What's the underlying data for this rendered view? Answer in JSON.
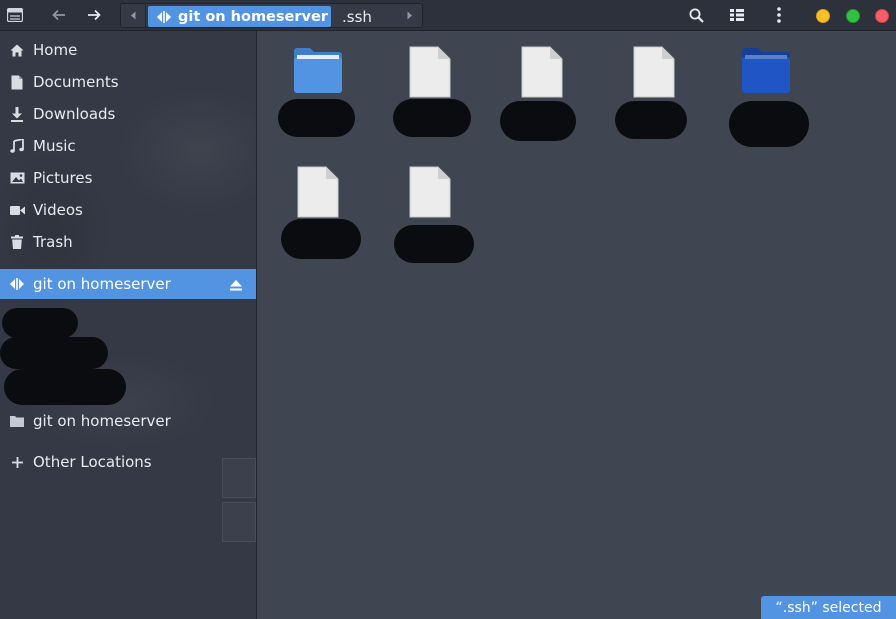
{
  "header": {
    "menu_icon": "sidebar-toggle-icon",
    "back_icon": "arrow-left-icon",
    "forward_icon": "arrow-right-icon",
    "path": {
      "left_icon": "chevron-left-icon",
      "active_crumb": "git on homeserver",
      "active_crumb_icon": "network-share-icon",
      "current_crumb": ".ssh",
      "right_icon": "chevron-right-icon"
    },
    "search_icon": "search-icon",
    "view_icon": "view-options-icon",
    "more_icon": "kebab-menu-icon",
    "window_controls": {
      "minimize_color": "#fdbe27",
      "maximize_color": "#2fc240",
      "close_color": "#f46067"
    }
  },
  "sidebar": {
    "places": [
      {
        "label": "Home",
        "icon": "home-icon"
      },
      {
        "label": "Documents",
        "icon": "document-icon"
      },
      {
        "label": "Downloads",
        "icon": "download-icon"
      },
      {
        "label": "Music",
        "icon": "music-icon"
      },
      {
        "label": "Pictures",
        "icon": "picture-icon"
      },
      {
        "label": "Videos",
        "icon": "video-icon"
      },
      {
        "label": "Trash",
        "icon": "trash-icon"
      }
    ],
    "mounted": {
      "label": "git on homeserver",
      "icon": "network-share-icon",
      "eject_icon": "eject-icon"
    },
    "bookmark": {
      "label": "git on homeserver",
      "icon": "folder-icon"
    },
    "other": {
      "label": "Other Locations",
      "icon": "plus-icon"
    }
  },
  "files": [
    {
      "type": "folder",
      "color": "#5294e2"
    },
    {
      "type": "file"
    },
    {
      "type": "file"
    },
    {
      "type": "file"
    },
    {
      "type": "folder",
      "color": "#1f55c4"
    },
    {
      "type": "file"
    },
    {
      "type": "file"
    }
  ],
  "status": {
    "text": "“.ssh” selected"
  },
  "colors": {
    "accent": "#5294e2",
    "background": "#404552",
    "sidebar": "#353945",
    "header": "#2c313c"
  }
}
